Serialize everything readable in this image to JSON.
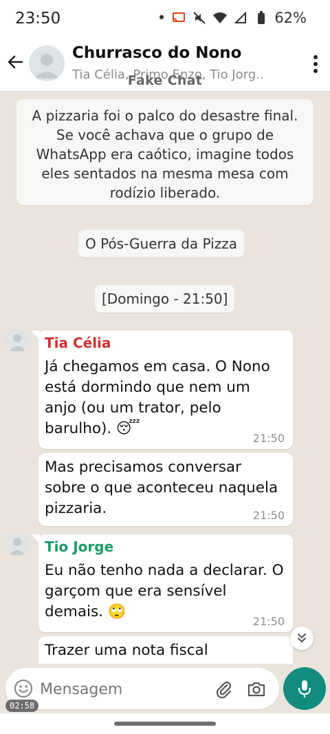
{
  "status": {
    "time": "23:50",
    "battery": "62%",
    "dot": "•"
  },
  "header": {
    "title": "Churrasco do Nono",
    "subtitle": "Tia Célia, Primo Enzo, Tio Jorg..",
    "watermark": "Fake Chat"
  },
  "chat": {
    "intro": "A pizzaria foi o palco do desastre final. Se você achava que o grupo de WhatsApp era caótico, imagine todos eles sentados na mesma mesa com rodízio liberado.",
    "section_title": "O Pós-Guerra da Pizza",
    "date_chip": "[Domingo - 21:50]",
    "messages": [
      {
        "sender": "Tia Célia",
        "text": "Já chegamos em casa. O Nono está dormindo que nem um anjo (ou um trator, pelo barulho). 😴",
        "time": "21:50"
      },
      {
        "text": "Mas precisamos conversar sobre o que aconteceu naquela pizzaria.",
        "time": "21:50"
      },
      {
        "sender": "Tio Jorge",
        "text": "Eu não tenho nada a declarar. O garçom que era sensível demais. 🙄",
        "time": "21:50"
      },
      {
        "text": "Trazer uma nota fiscal"
      }
    ]
  },
  "composer": {
    "placeholder": "Mensagem",
    "recording_time": "02:58"
  },
  "colors": {
    "tia_celia": "#d32f2f",
    "tio_jorge": "#1e9a6a",
    "accent": "#128c7e"
  },
  "icons": [
    "back-arrow-icon",
    "more-vert-icon",
    "emoji-icon",
    "attach-icon",
    "camera-icon",
    "mic-icon",
    "scroll-down-icon"
  ]
}
